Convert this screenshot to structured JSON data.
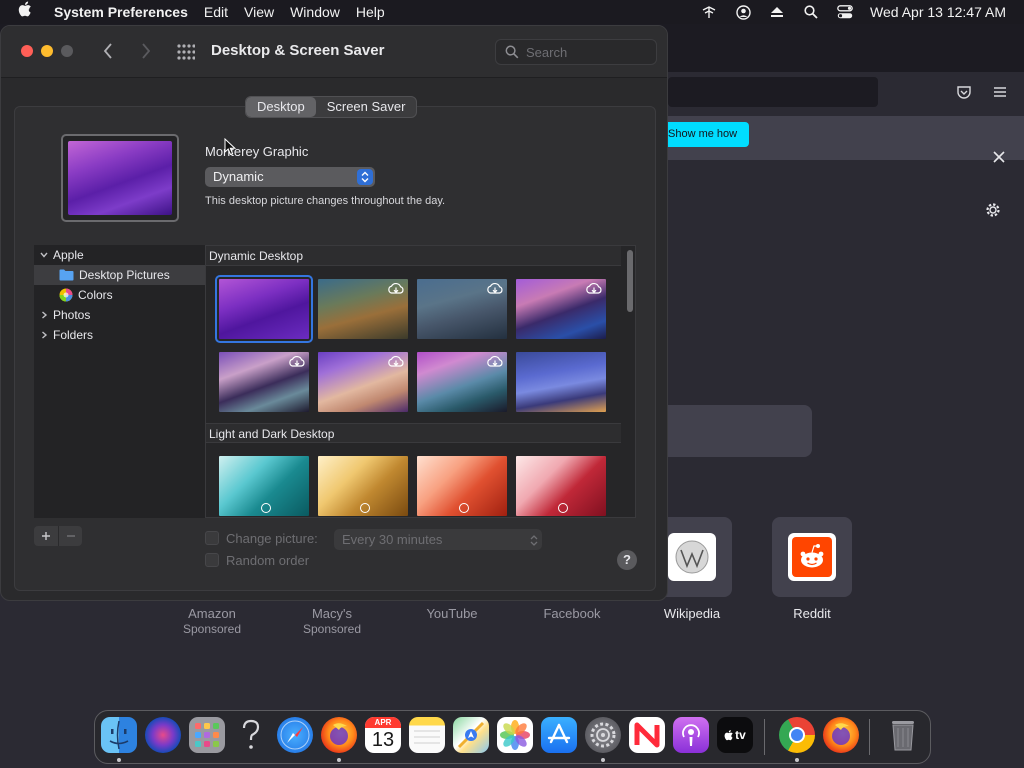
{
  "menubar": {
    "app_name": "System Preferences",
    "items": [
      "Edit",
      "View",
      "Window",
      "Help"
    ],
    "clock": "Wed Apr 13  12:47 AM",
    "status_icons": [
      "wifi-icon",
      "user-icon",
      "eject-icon",
      "spotlight-icon",
      "control-center-icon"
    ]
  },
  "browser": {
    "notification": {
      "button_label": "Show me how"
    },
    "top_sites": [
      {
        "name": "Amazon",
        "sponsored": "Sponsored"
      },
      {
        "name": "Macy's",
        "sponsored": "Sponsored"
      },
      {
        "name": "YouTube",
        "sponsored": ""
      },
      {
        "name": "Facebook",
        "sponsored": ""
      },
      {
        "name": "Wikipedia",
        "sponsored": ""
      },
      {
        "name": "Reddit",
        "sponsored": ""
      }
    ]
  },
  "window": {
    "title": "Desktop & Screen Saver",
    "search_placeholder": "Search",
    "tabs": [
      {
        "label": "Desktop",
        "active": true
      },
      {
        "label": "Screen Saver",
        "active": false
      }
    ],
    "picture_name": "Monterey Graphic",
    "style_value": "Dynamic",
    "description": "This desktop picture changes throughout the day.",
    "sources": [
      {
        "label": "Apple",
        "expanded": true,
        "level": 0
      },
      {
        "label": "Desktop Pictures",
        "level": 1,
        "selected": true,
        "icon": "folder-icon"
      },
      {
        "label": "Colors",
        "level": 1,
        "icon": "color-wheel-icon"
      },
      {
        "label": "Photos",
        "level": 0,
        "expanded": false
      },
      {
        "label": "Folders",
        "level": 0,
        "expanded": false
      }
    ],
    "sections": [
      {
        "title": "Dynamic Desktop"
      },
      {
        "title": "Light and Dark Desktop"
      }
    ],
    "change_picture_label": "Change picture:",
    "interval_value": "Every 30 minutes",
    "random_order_label": "Random order",
    "help_label": "?"
  },
  "dock": {
    "apps": [
      "Finder",
      "Siri",
      "Launchpad",
      "Help",
      "Safari",
      "Firefox",
      "Calendar",
      "Notes",
      "Maps",
      "Photos",
      "App Store",
      "System Preferences",
      "News",
      "Podcasts",
      "TV",
      "Chrome",
      "Firefox",
      "Trash"
    ],
    "calendar": {
      "month": "APR",
      "day": "13"
    },
    "tv_label": "tv"
  }
}
